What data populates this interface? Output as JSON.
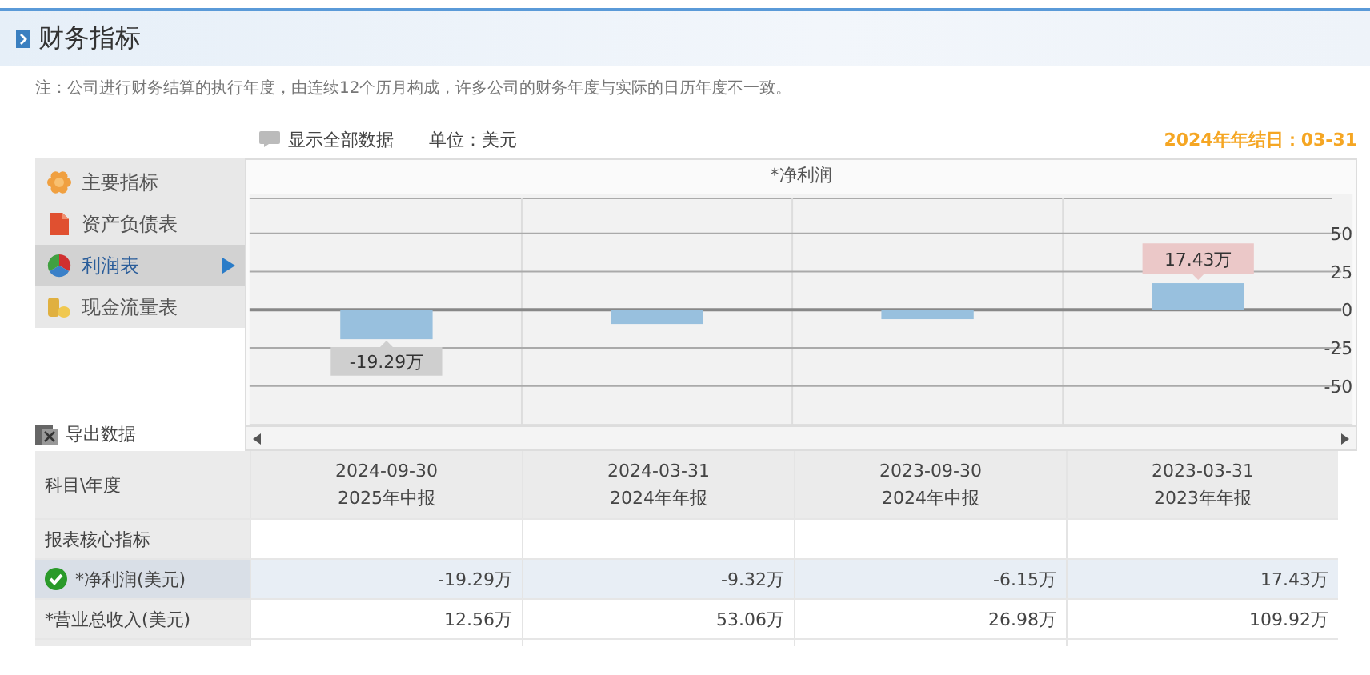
{
  "header": {
    "title": "财务指标"
  },
  "note": "注：公司进行财务结算的执行年度，由连续12个历月构成，许多公司的财务年度与实际的日历年度不一致。",
  "toolbar": {
    "show_all": "显示全部数据",
    "unit": "单位：美元",
    "fiscal_year_end": "2024年年结日：03-31"
  },
  "menu": [
    {
      "label": "主要指标",
      "selected": false
    },
    {
      "label": "资产负债表",
      "selected": false
    },
    {
      "label": "利润表",
      "selected": true
    },
    {
      "label": "现金流量表",
      "selected": false
    }
  ],
  "export": "导出数据",
  "chart": {
    "chart_data": {
      "type": "bar",
      "title": "*净利润",
      "values": [
        -19.29,
        -9.32,
        -6.15,
        17.43
      ],
      "ylim": [
        -76,
        73
      ],
      "yticks": [
        -50,
        -25,
        0,
        25,
        50
      ],
      "grid": true,
      "annotations": [
        {
          "y": -19.29,
          "text": "-19.29万"
        },
        {
          "y": 17.43,
          "text": "17.43万"
        }
      ]
    }
  },
  "table": {
    "corner": "科目\\年度",
    "columns": [
      {
        "date": "2024-09-30",
        "report": "2025年中报"
      },
      {
        "date": "2024-03-31",
        "report": "2024年年报"
      },
      {
        "date": "2023-09-30",
        "report": "2024年中报"
      },
      {
        "date": "2023-03-31",
        "report": "2023年年报"
      }
    ],
    "rows": [
      {
        "kind": "section",
        "label": "报表核心指标"
      },
      {
        "kind": "metric",
        "label": "*净利润(美元)",
        "selected": true,
        "cells": [
          "-19.29万",
          "-9.32万",
          "-6.15万",
          "17.43万"
        ]
      },
      {
        "kind": "metric",
        "label": "*营业总收入(美元)",
        "selected": false,
        "cells": [
          "12.56万",
          "53.06万",
          "26.98万",
          "109.92万"
        ]
      }
    ]
  }
}
